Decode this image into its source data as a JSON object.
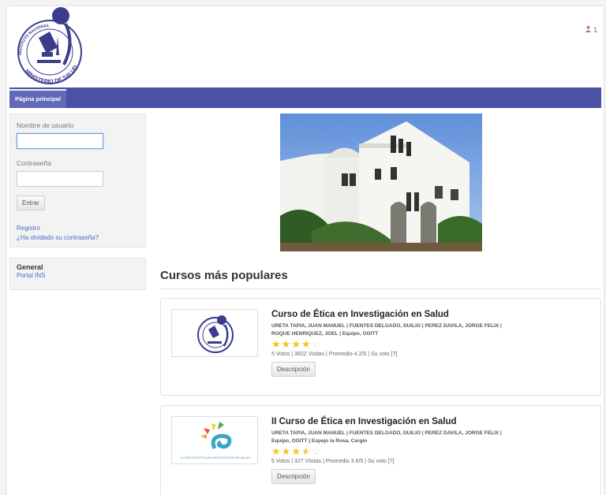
{
  "header": {
    "logo_text_top": "INSTITUTO NACIONAL DE SALUD",
    "logo_text_bottom": "MINISTERIO DE SALUD",
    "user_count": "1"
  },
  "nav": {
    "home_tab": "Página principal"
  },
  "login": {
    "username_label": "Nombre de usuario",
    "username_value": "",
    "password_label": "Contraseña",
    "password_value": "",
    "submit_label": "Entrar",
    "register_link": "Registro",
    "forgot_link": "¿Ha olvidado su contraseña?"
  },
  "general": {
    "heading": "General",
    "link": "Portal INS"
  },
  "main": {
    "section_title": "Cursos más populares",
    "courses": [
      {
        "title": "Curso de Ética en Investigación en Salud",
        "teachers": "URETA TAPIA, JUAN MANUEL | FUENTES DELGADO, DUILIO | PEREZ DAVILA, JORGE FELIX | ROQUE HENRIQUEZ, JOEL | Equipo, OGITT",
        "rating": 4,
        "meta": "5 Votos | 3822 Visitas | Promedio 4.2/5 | Su voto [?]",
        "button": "Descripción"
      },
      {
        "title": "II Curso de Ética en Investigación en Salud",
        "teachers": "URETA TAPIA, JUAN MANUEL | FUENTES DELGADO, DUILIO | PEREZ DAVILA, JORGE FELIX | Equipo, OGITT | Espejo la Rosa, Cergio",
        "rating": 3.5,
        "meta": "5 Votos | 327 Visitas | Promedio 3.6/5 | Su voto [?]",
        "button": "Descripción",
        "thumb_caption": "II CURSO DE ÉTICA EN INVESTIGACIÓN EN SALUD"
      }
    ]
  },
  "colors": {
    "nav": "#4a52a3",
    "tab": "#6269b8",
    "link": "#4b6bc6",
    "star": "#f5c518"
  }
}
